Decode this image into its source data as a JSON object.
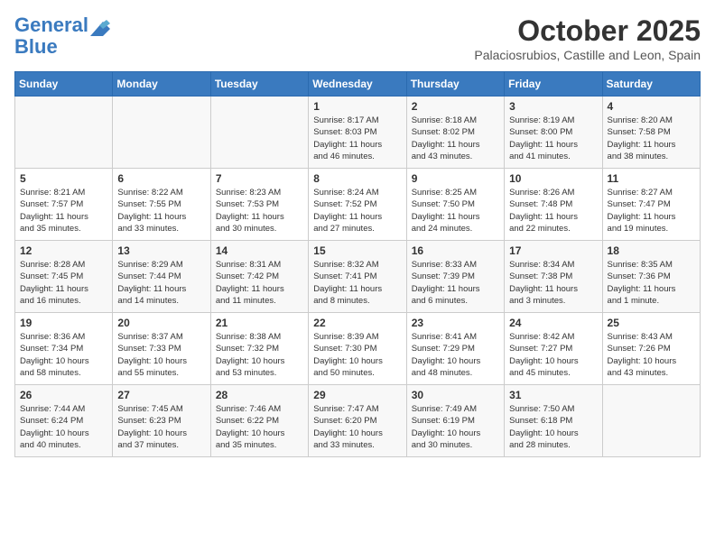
{
  "header": {
    "logo_line1": "General",
    "logo_line2": "Blue",
    "month": "October 2025",
    "location": "Palaciosrubios, Castille and Leon, Spain"
  },
  "days_of_week": [
    "Sunday",
    "Monday",
    "Tuesday",
    "Wednesday",
    "Thursday",
    "Friday",
    "Saturday"
  ],
  "weeks": [
    [
      {
        "day": "",
        "info": ""
      },
      {
        "day": "",
        "info": ""
      },
      {
        "day": "",
        "info": ""
      },
      {
        "day": "1",
        "info": "Sunrise: 8:17 AM\nSunset: 8:03 PM\nDaylight: 11 hours\nand 46 minutes."
      },
      {
        "day": "2",
        "info": "Sunrise: 8:18 AM\nSunset: 8:02 PM\nDaylight: 11 hours\nand 43 minutes."
      },
      {
        "day": "3",
        "info": "Sunrise: 8:19 AM\nSunset: 8:00 PM\nDaylight: 11 hours\nand 41 minutes."
      },
      {
        "day": "4",
        "info": "Sunrise: 8:20 AM\nSunset: 7:58 PM\nDaylight: 11 hours\nand 38 minutes."
      }
    ],
    [
      {
        "day": "5",
        "info": "Sunrise: 8:21 AM\nSunset: 7:57 PM\nDaylight: 11 hours\nand 35 minutes."
      },
      {
        "day": "6",
        "info": "Sunrise: 8:22 AM\nSunset: 7:55 PM\nDaylight: 11 hours\nand 33 minutes."
      },
      {
        "day": "7",
        "info": "Sunrise: 8:23 AM\nSunset: 7:53 PM\nDaylight: 11 hours\nand 30 minutes."
      },
      {
        "day": "8",
        "info": "Sunrise: 8:24 AM\nSunset: 7:52 PM\nDaylight: 11 hours\nand 27 minutes."
      },
      {
        "day": "9",
        "info": "Sunrise: 8:25 AM\nSunset: 7:50 PM\nDaylight: 11 hours\nand 24 minutes."
      },
      {
        "day": "10",
        "info": "Sunrise: 8:26 AM\nSunset: 7:48 PM\nDaylight: 11 hours\nand 22 minutes."
      },
      {
        "day": "11",
        "info": "Sunrise: 8:27 AM\nSunset: 7:47 PM\nDaylight: 11 hours\nand 19 minutes."
      }
    ],
    [
      {
        "day": "12",
        "info": "Sunrise: 8:28 AM\nSunset: 7:45 PM\nDaylight: 11 hours\nand 16 minutes."
      },
      {
        "day": "13",
        "info": "Sunrise: 8:29 AM\nSunset: 7:44 PM\nDaylight: 11 hours\nand 14 minutes."
      },
      {
        "day": "14",
        "info": "Sunrise: 8:31 AM\nSunset: 7:42 PM\nDaylight: 11 hours\nand 11 minutes."
      },
      {
        "day": "15",
        "info": "Sunrise: 8:32 AM\nSunset: 7:41 PM\nDaylight: 11 hours\nand 8 minutes."
      },
      {
        "day": "16",
        "info": "Sunrise: 8:33 AM\nSunset: 7:39 PM\nDaylight: 11 hours\nand 6 minutes."
      },
      {
        "day": "17",
        "info": "Sunrise: 8:34 AM\nSunset: 7:38 PM\nDaylight: 11 hours\nand 3 minutes."
      },
      {
        "day": "18",
        "info": "Sunrise: 8:35 AM\nSunset: 7:36 PM\nDaylight: 11 hours\nand 1 minute."
      }
    ],
    [
      {
        "day": "19",
        "info": "Sunrise: 8:36 AM\nSunset: 7:34 PM\nDaylight: 10 hours\nand 58 minutes."
      },
      {
        "day": "20",
        "info": "Sunrise: 8:37 AM\nSunset: 7:33 PM\nDaylight: 10 hours\nand 55 minutes."
      },
      {
        "day": "21",
        "info": "Sunrise: 8:38 AM\nSunset: 7:32 PM\nDaylight: 10 hours\nand 53 minutes."
      },
      {
        "day": "22",
        "info": "Sunrise: 8:39 AM\nSunset: 7:30 PM\nDaylight: 10 hours\nand 50 minutes."
      },
      {
        "day": "23",
        "info": "Sunrise: 8:41 AM\nSunset: 7:29 PM\nDaylight: 10 hours\nand 48 minutes."
      },
      {
        "day": "24",
        "info": "Sunrise: 8:42 AM\nSunset: 7:27 PM\nDaylight: 10 hours\nand 45 minutes."
      },
      {
        "day": "25",
        "info": "Sunrise: 8:43 AM\nSunset: 7:26 PM\nDaylight: 10 hours\nand 43 minutes."
      }
    ],
    [
      {
        "day": "26",
        "info": "Sunrise: 7:44 AM\nSunset: 6:24 PM\nDaylight: 10 hours\nand 40 minutes."
      },
      {
        "day": "27",
        "info": "Sunrise: 7:45 AM\nSunset: 6:23 PM\nDaylight: 10 hours\nand 37 minutes."
      },
      {
        "day": "28",
        "info": "Sunrise: 7:46 AM\nSunset: 6:22 PM\nDaylight: 10 hours\nand 35 minutes."
      },
      {
        "day": "29",
        "info": "Sunrise: 7:47 AM\nSunset: 6:20 PM\nDaylight: 10 hours\nand 33 minutes."
      },
      {
        "day": "30",
        "info": "Sunrise: 7:49 AM\nSunset: 6:19 PM\nDaylight: 10 hours\nand 30 minutes."
      },
      {
        "day": "31",
        "info": "Sunrise: 7:50 AM\nSunset: 6:18 PM\nDaylight: 10 hours\nand 28 minutes."
      },
      {
        "day": "",
        "info": ""
      }
    ]
  ]
}
